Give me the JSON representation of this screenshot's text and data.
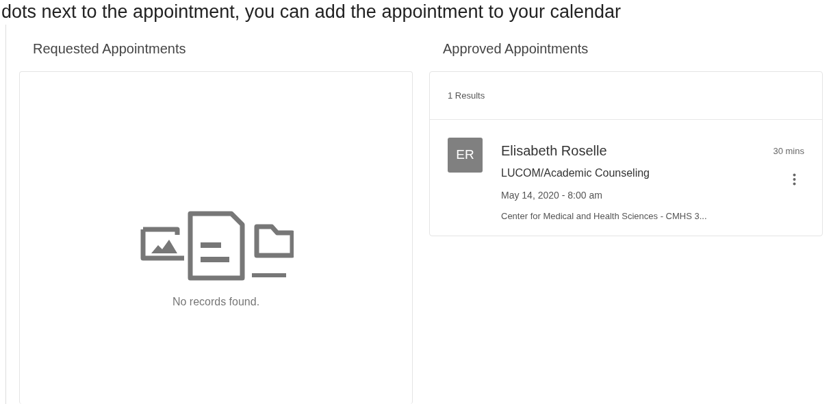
{
  "intro_text": "dots next to the appointment, you can add the appointment to your calendar",
  "requested": {
    "heading": "Requested Appointments",
    "empty_message": "No records found."
  },
  "approved": {
    "heading": "Approved Appointments",
    "count": "1 Results",
    "appointments": [
      {
        "initials": "ER",
        "name": "Elisabeth Roselle",
        "duration": "30 mins",
        "service": "LUCOM/Academic Counseling",
        "datetime": "May 14, 2020 - 8:00 am",
        "location": "Center for Medical and Health Sciences - CMHS 3..."
      }
    ]
  }
}
